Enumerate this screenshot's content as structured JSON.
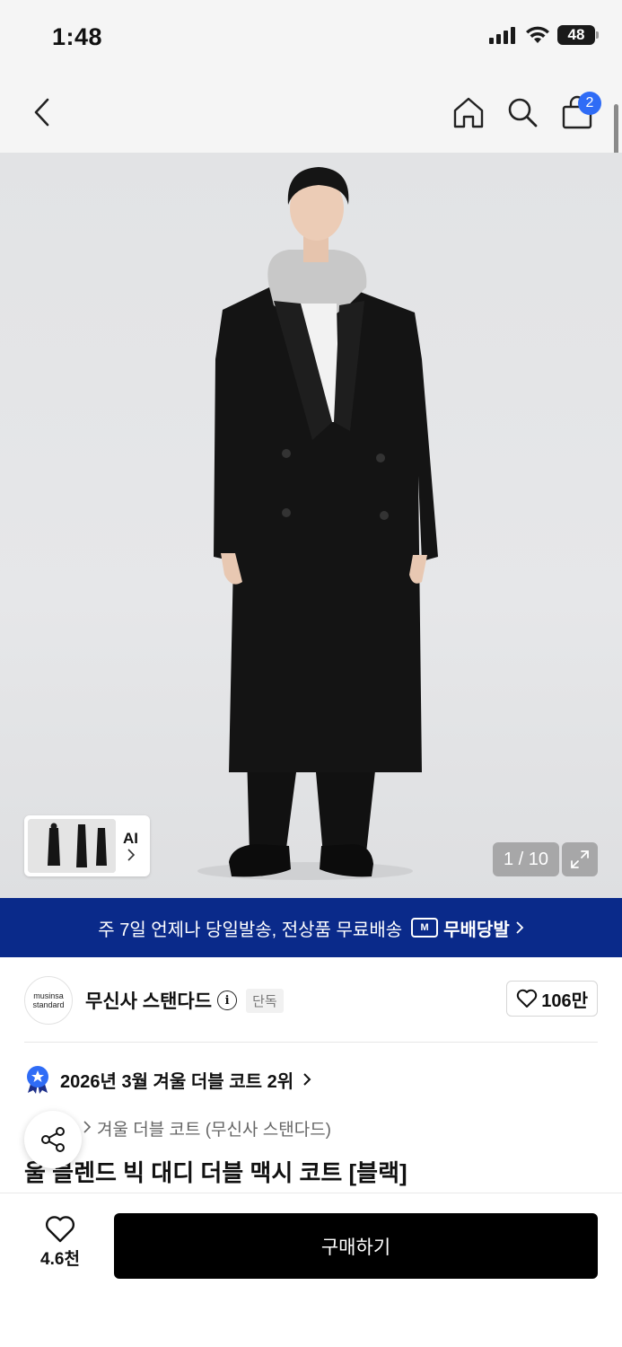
{
  "status_bar": {
    "time": "1:48",
    "battery": "48"
  },
  "nav": {
    "cart_count": "2"
  },
  "gallery": {
    "thumb_label": "AI",
    "page_counter": "1 / 10"
  },
  "banner": {
    "text": "주 7일 언제나 당일발송, 전상품 무료배송",
    "brand": "무배당발",
    "logo_letter": "M"
  },
  "brand": {
    "logo_line1": "musinsa",
    "logo_line2": "standard",
    "name": "무신사 스탠다드",
    "info_symbol": "i",
    "badge": "단독",
    "likes": "106만"
  },
  "ranking": {
    "text": "2026년 3월 겨울 더블 코트 2위"
  },
  "breadcrumb": {
    "category": "겨울 더블 코트 (무신사 스탠다드)"
  },
  "product": {
    "title": "울 블렌드 빅 대디 더블 맥시 코트 [블랙]"
  },
  "bottom_bar": {
    "wish_count": "4.6천",
    "buy_label": "구매하기"
  },
  "colors": {
    "banner_bg": "#0a2a8a",
    "badge_blue": "#2f6cf6",
    "buy_bg": "#000000"
  }
}
